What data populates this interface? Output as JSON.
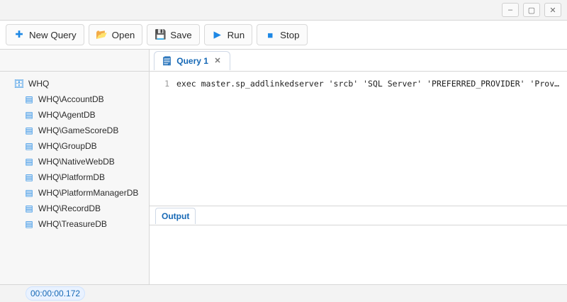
{
  "window": {
    "title": "",
    "controls": {
      "minimize_icon": "minimize-icon",
      "maximize_icon": "maximize-icon",
      "close_icon": "close-icon"
    }
  },
  "toolbar": {
    "new_query_label": "New Query",
    "open_label": "Open",
    "save_label": "Save",
    "run_label": "Run",
    "stop_label": "Stop"
  },
  "sidebar": {
    "title": "",
    "items": [
      {
        "label": "WHQ"
      },
      {
        "label": "WHQ\\AccountDB"
      },
      {
        "label": "WHQ\\AgentDB"
      },
      {
        "label": "WHQ\\GameScoreDB"
      },
      {
        "label": "WHQ\\GroupDB"
      },
      {
        "label": "WHQ\\NativeWebDB"
      },
      {
        "label": "WHQ\\PlatformDB"
      },
      {
        "label": "WHQ\\PlatformManagerDB"
      },
      {
        "label": "WHQ\\RecordDB"
      },
      {
        "label": "WHQ\\TreasureDB"
      }
    ]
  },
  "tabs": [
    {
      "label": "Query 1"
    }
  ],
  "editor": {
    "lines": [
      "exec master.sp_addlinkedserver 'srcb' 'SQL Server' 'PREFERRED_PROVIDER' 'Provider.Value' ..."
    ]
  },
  "output": {
    "tab_label": "Output",
    "text": ""
  },
  "status": {
    "encoding": "",
    "line_col": "",
    "time": "00:00:00.172"
  }
}
